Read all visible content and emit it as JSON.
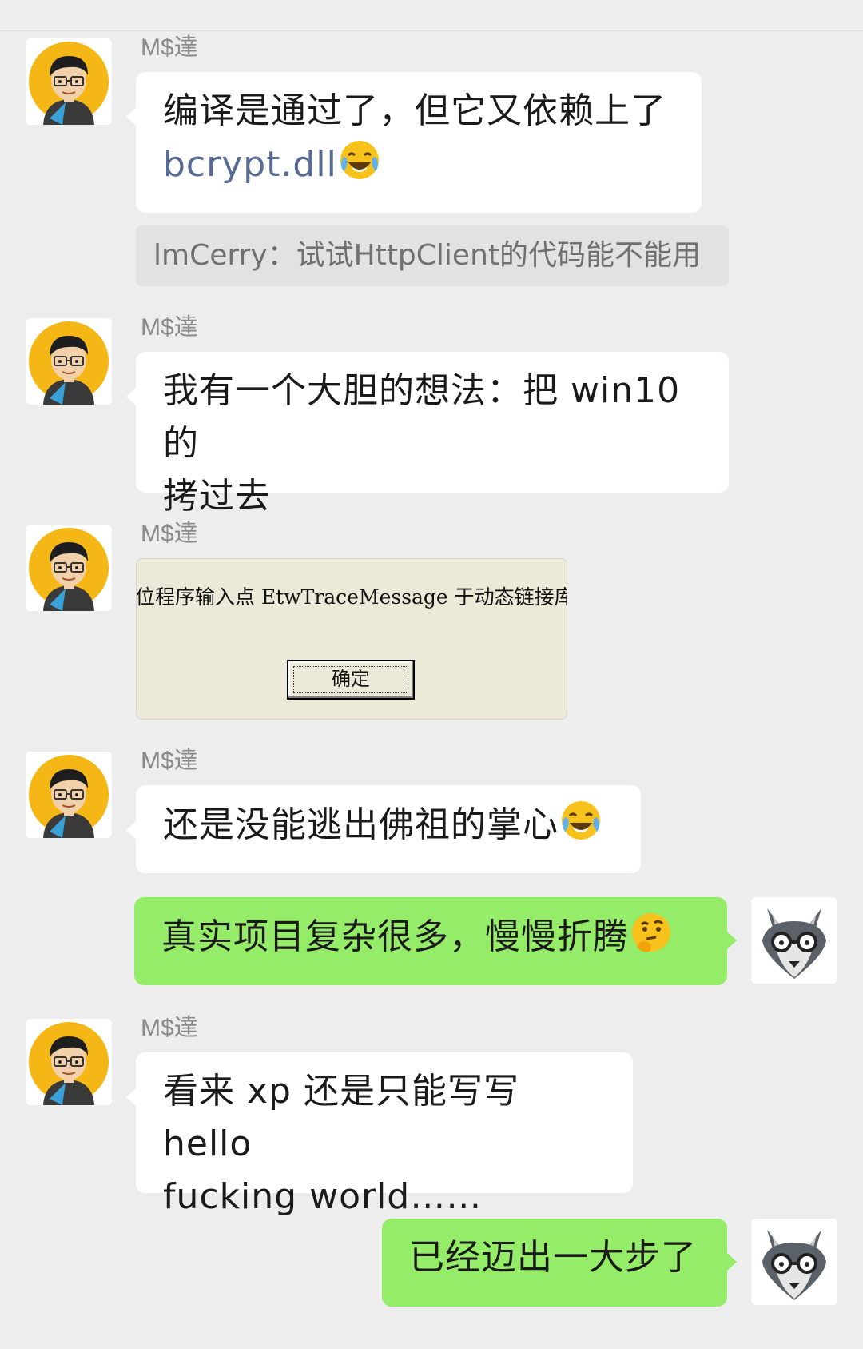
{
  "conversation": {
    "messages": [
      {
        "sender": "M$達",
        "text_part1": "编译是通过了，但它又依赖上了",
        "text_link": "bcrypt.dll",
        "emoji": "face-with-tears-of-joy"
      },
      {
        "quote": "lmCerry：试试HttpClient的代码能不能用"
      },
      {
        "sender": "M$達",
        "text_line1": "我有一个大胆的想法：把 win10 的",
        "text_line2": "拷过去"
      },
      {
        "sender": "M$達",
        "image": {
          "dialog_text": "位程序输入点 EtwTraceMessage 于动态链接库 r",
          "ok_button": "确定"
        }
      },
      {
        "sender": "M$達",
        "text": "还是没能逃出佛祖的掌心",
        "emoji": "face-with-tears-of-joy"
      },
      {
        "self": true,
        "text": "真实项目复杂很多，慢慢折腾",
        "emoji": "thinking-face"
      },
      {
        "sender": "M$達",
        "text_line1": "看来 xp 还是只能写写 hello",
        "text_line2": "fucking world……"
      },
      {
        "self": true,
        "text": "已经迈出一大步了"
      }
    ]
  },
  "colors": {
    "background": "#ededed",
    "incoming_bubble": "#ffffff",
    "outgoing_bubble": "#95ec69",
    "link": "#576b95",
    "sender_name": "#8a8a8a"
  }
}
